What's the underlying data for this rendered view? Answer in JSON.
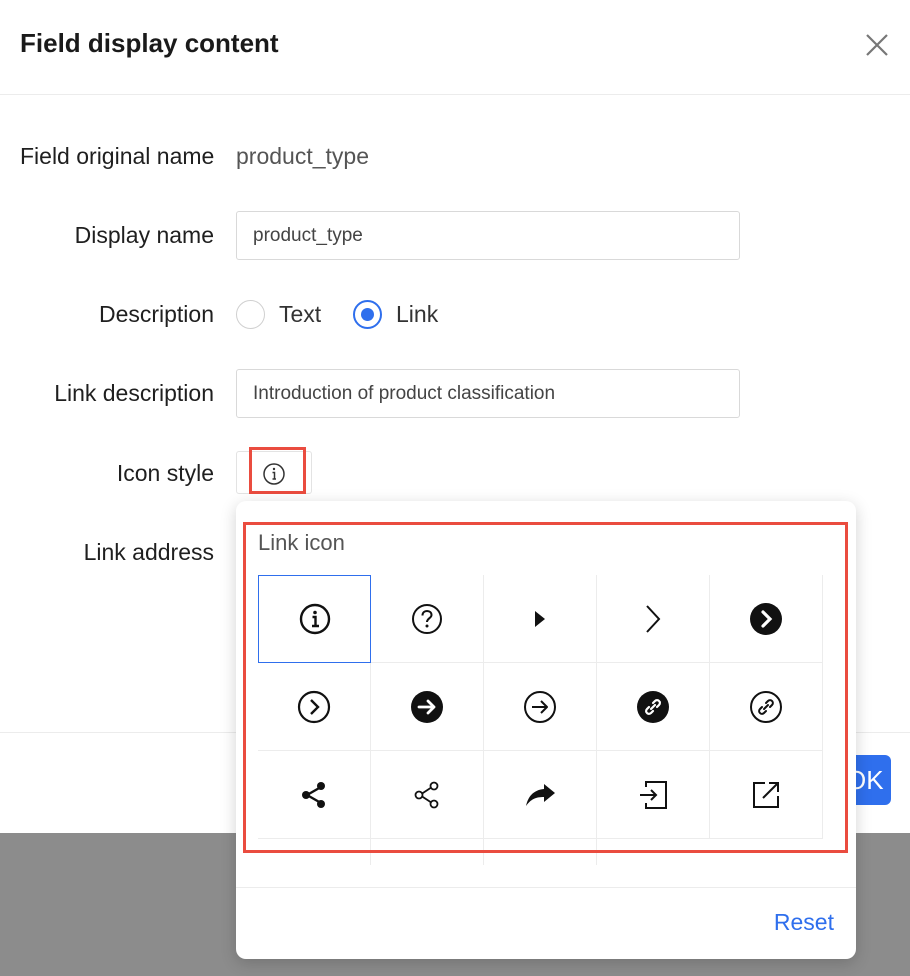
{
  "dialog": {
    "title": "Field display content",
    "close_icon": "close-icon"
  },
  "form": {
    "original_name_label": "Field original name",
    "original_name_value": "product_type",
    "display_name_label": "Display name",
    "display_name_value": "product_type",
    "description_label": "Description",
    "description_options": [
      {
        "label": "Text",
        "checked": false
      },
      {
        "label": "Link",
        "checked": true
      }
    ],
    "link_description_label": "Link description",
    "link_description_value": "Introduction of product classification",
    "icon_style_label": "Icon style",
    "icon_style_selected": "info-circle-icon",
    "link_address_label": "Link address"
  },
  "footer": {
    "ok_label": "OK"
  },
  "popover": {
    "title": "Link icon",
    "selected_index": 0,
    "icons": [
      "info-circle-icon",
      "question-circle-icon",
      "caret-right-icon",
      "chevron-right-icon",
      "chevron-right-filled-circle-icon",
      "chevron-right-circle-icon",
      "arrow-right-filled-circle-icon",
      "arrow-right-circle-icon",
      "link-filled-circle-icon",
      "link-circle-icon",
      "share-filled-icon",
      "share-outline-icon",
      "forward-arrow-icon",
      "login-box-icon",
      "external-link-icon"
    ],
    "reset_label": "Reset"
  },
  "colors": {
    "primary": "#2f6fed",
    "highlight": "#ea4c3f"
  }
}
